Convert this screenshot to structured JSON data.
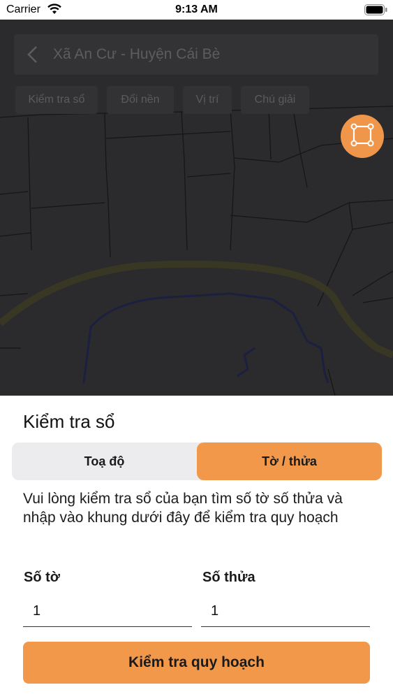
{
  "status_bar": {
    "carrier": "Carrier",
    "time": "9:13 AM",
    "icons": [
      "wifi-icon",
      "battery-icon"
    ]
  },
  "map": {
    "header": {
      "back_icon": "chevron-left-icon",
      "title": "Xã An Cư - Huyện Cái Bè"
    },
    "chips": [
      "Kiểm tra sổ",
      "Đổi nền",
      "Vị trí",
      "Chú giải"
    ],
    "fab_icon": "polygon-select-icon",
    "colors": {
      "fab": "#f0964a",
      "overlay": "#2b2a2c"
    }
  },
  "sheet": {
    "title": "Kiểm tra sổ",
    "segments": [
      {
        "label": "Toạ độ",
        "selected": false
      },
      {
        "label": "Tờ / thửa",
        "selected": true
      }
    ],
    "description": "Vui lòng kiểm tra sổ của bạn tìm số tờ số thửa và nhập vào khung dưới đây để kiểm tra quy hoạch",
    "fields": {
      "sheet_no": {
        "label": "Số tờ",
        "value": "1"
      },
      "parcel_no": {
        "label": "Số thửa",
        "value": "1"
      }
    },
    "submit_label": "Kiểm tra quy hoạch",
    "accent_color": "#f1984b"
  }
}
